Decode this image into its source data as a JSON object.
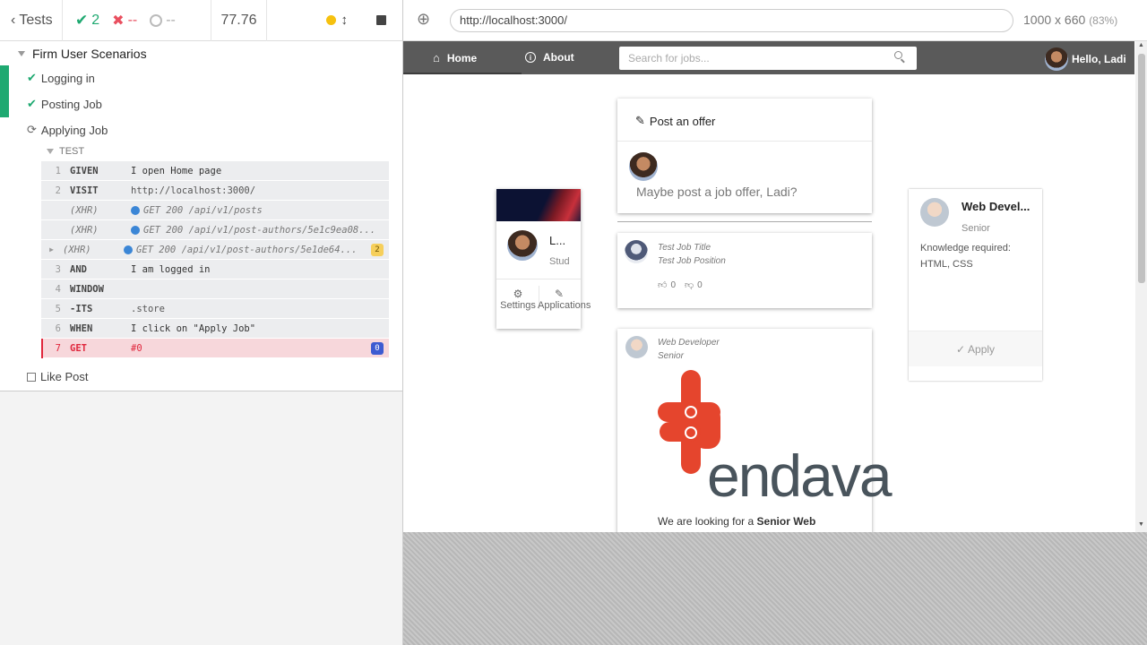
{
  "reporter": {
    "tests_label": "Tests",
    "passed": "2",
    "failed": "--",
    "pending": "--",
    "duration": "77.76"
  },
  "suite": {
    "title": "Firm User Scenarios",
    "tests": [
      "Logging in",
      "Posting Job",
      "Applying Job",
      "Like Post"
    ],
    "section_label": "TEST"
  },
  "commands": [
    {
      "num": "1",
      "name": "GIVEN",
      "msg": "I open Home page"
    },
    {
      "num": "2",
      "name": "VISIT",
      "msg": "http://localhost:3000/"
    },
    {
      "num": "",
      "name": "(XHR)",
      "msg": "GET 200 /api/v1/posts"
    },
    {
      "num": "",
      "name": "(XHR)",
      "msg": "GET 200 /api/v1/post-authors/5e1c9ea08..."
    },
    {
      "num": "",
      "name": "(XHR)",
      "msg": "GET 200 /api/v1/post-authors/5e1de64...",
      "badge": "2"
    },
    {
      "num": "3",
      "name": "AND",
      "msg": "I am logged in"
    },
    {
      "num": "4",
      "name": "WINDOW",
      "msg": ""
    },
    {
      "num": "5",
      "name": "-ITS",
      "msg": ".store"
    },
    {
      "num": "6",
      "name": "WHEN",
      "msg": "I click on \"Apply Job\""
    },
    {
      "num": "7",
      "name": "GET",
      "msg": "#0",
      "badge": "0"
    }
  ],
  "browser": {
    "url": "http://localhost:3000/",
    "viewport": "1000 x 660",
    "zoom": "(83%)"
  },
  "app": {
    "nav_home": "Home",
    "nav_about": "About",
    "search_placeholder": "Search for jobs...",
    "greeting": "Hello, Ladi",
    "profile_name": "L...",
    "profile_role": "Stud",
    "settings_label": "Settings",
    "applications_label": "Applications",
    "post_offer_title": "Post an offer",
    "post_offer_placeholder": "Maybe post a job offer, Ladi?",
    "post1_title": "Test Job Title",
    "post1_position": "Test Job Position",
    "post1_likes": "0",
    "post1_dislikes": "0",
    "post2_title": "Web Developer",
    "post2_position": "Senior",
    "post2_text_prefix": "We are looking for a ",
    "post2_text_bold": "Senior Web",
    "company_logo_text": "endava",
    "job_card_title": "Web Devel...",
    "job_card_level": "Senior",
    "job_card_req_label": "Knowledge required:",
    "job_card_req": "HTML, CSS",
    "apply_label": "Apply"
  },
  "colors": {
    "pass": "#1fa971",
    "fail": "#e94f5f",
    "nav_bg": "#5a5a5a",
    "endava_orange": "#e5452d",
    "endava_gray": "#49545c"
  }
}
